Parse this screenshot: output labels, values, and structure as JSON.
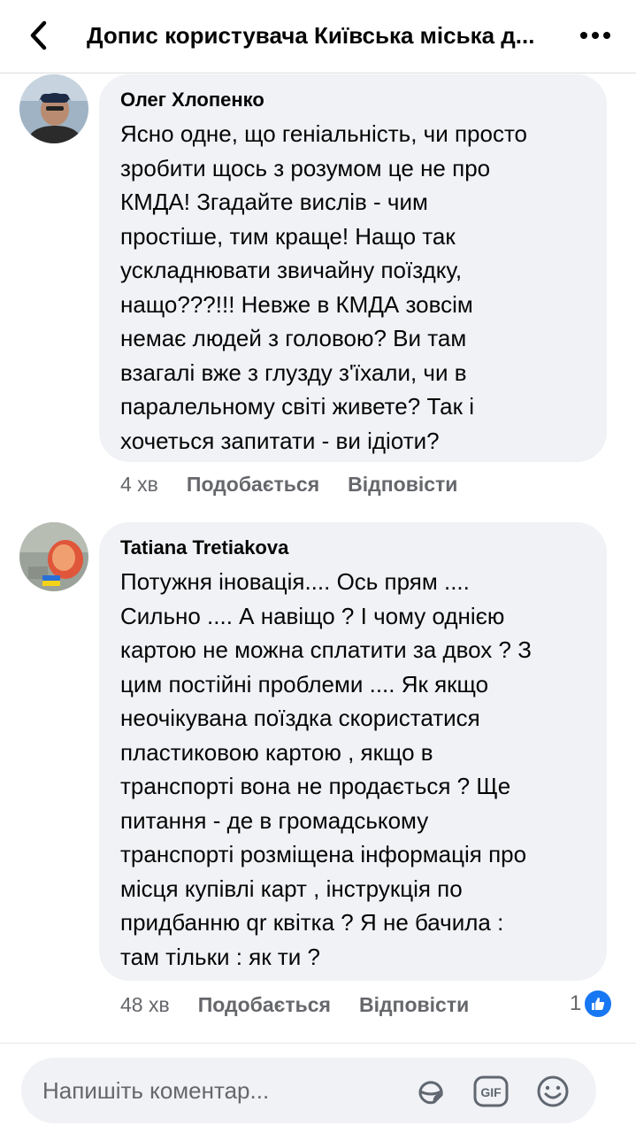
{
  "header": {
    "title": "Допис користувача Київська міська д..."
  },
  "comments": [
    {
      "author": "Олег Хлопенко",
      "text": "Ясно одне, що геніальність, чи просто\nзробити щось з розумом це не про\nКМДА! Згадайте вислів - чим\nпростіше, тим краще! Нащо так\nускладнювати звичайну поїздку,\nнащо???!!! Невже в КМДА зовсім\nнемає людей з головою? Ви там\nвзагалі вже з глузду з'їхали, чи в\nпаралельному світі живете? Так і\nхочеться запитати - ви ідіоти?",
      "time": "4 хв",
      "like_label": "Подобається",
      "reply_label": "Відповісти"
    },
    {
      "author": "Tatiana Tretiakova",
      "text": "Потужня іновація.... Ось прям ....\nСильно .... А навіщо ? І чому однією\nкартою не можна сплатити за двох ? З\nцим постійні проблеми .... Як якщо\nнеочікувана поїздка скористатися\nпластиковою картою , якщо в\nтранспорті вона не продається ? Ще\nпитання - де в громадському\nтранспорті розміщена інформація про\nмісця купівлі карт , інструкція по\nпридбанню qr квітка ? Я не бачила :\nтам тільки : як ти ?",
      "time": "48 хв",
      "like_label": "Подобається",
      "reply_label": "Відповісти",
      "reaction_count": "1"
    }
  ],
  "composer": {
    "placeholder": "Напишіть коментар...",
    "icons": [
      "sticker-icon",
      "gif-icon",
      "emoji-icon"
    ]
  },
  "colors": {
    "bubble": "#f0f2f5",
    "meta_text": "#65676b",
    "like_blue": "#1877f2"
  }
}
